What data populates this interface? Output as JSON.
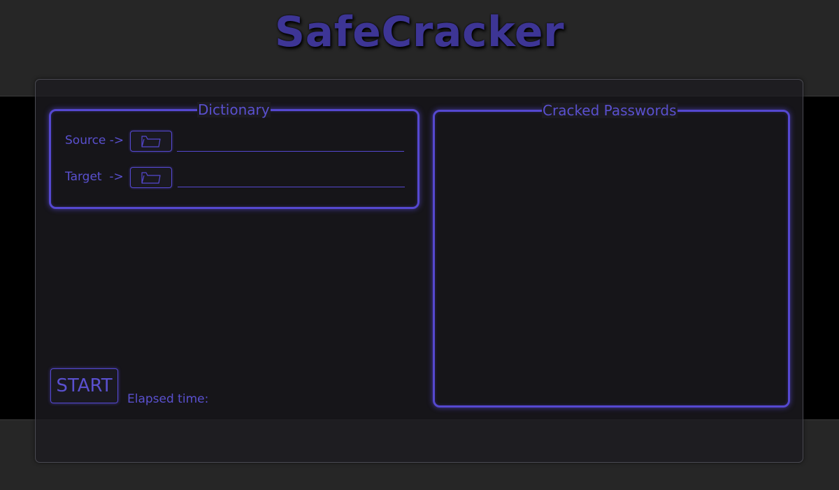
{
  "app": {
    "title": "SafeCracker"
  },
  "dictionary": {
    "legend": "Dictionary",
    "source": {
      "label": "Source ->",
      "button_icon": "folder-open-icon",
      "path_value": ""
    },
    "target": {
      "label": "Target  ->",
      "button_icon": "folder-open-icon",
      "path_value": ""
    }
  },
  "cracked_passwords": {
    "legend": "Cracked Passwords",
    "items": []
  },
  "controls": {
    "start_label": "START",
    "elapsed_label": "Elapsed time:",
    "elapsed_value": ""
  },
  "colors": {
    "accent": "#5548d0",
    "text": "#5a50cf",
    "title": "#3d3595",
    "panel_bg": "#1c1b21",
    "page_bg": "#252525"
  }
}
